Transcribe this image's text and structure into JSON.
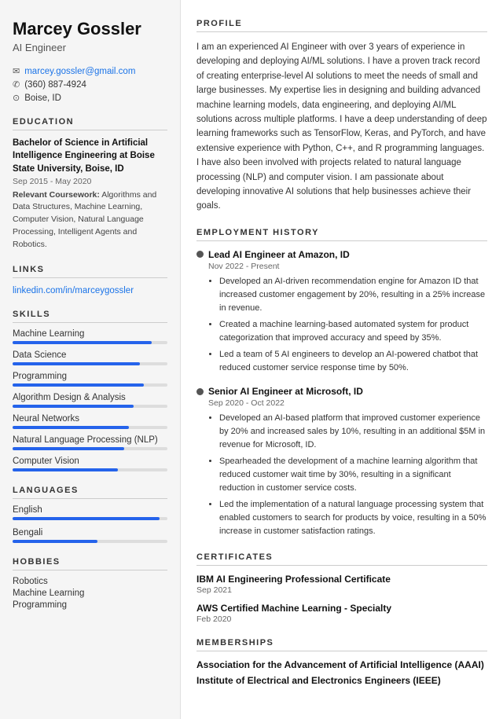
{
  "sidebar": {
    "name": "Marcey Gossler",
    "job_title": "AI Engineer",
    "contact": {
      "email": "marcey.gossler@gmail.com",
      "phone": "(360) 887-4924",
      "location": "Boise, ID"
    },
    "education": {
      "degree": "Bachelor of Science in Artificial Intelligence Engineering at Boise State University, Boise, ID",
      "dates": "Sep 2015 - May 2020",
      "coursework_label": "Relevant Coursework:",
      "coursework": "Algorithms and Data Structures, Machine Learning, Computer Vision, Natural Language Processing, Intelligent Agents and Robotics."
    },
    "links": {
      "label": "linkedin.com/in/marceygossler",
      "href": "linkedin.com/in/marceygossler"
    },
    "skills": [
      {
        "name": "Machine Learning",
        "pct": 90
      },
      {
        "name": "Data Science",
        "pct": 82
      },
      {
        "name": "Programming",
        "pct": 85
      },
      {
        "name": "Algorithm Design & Analysis",
        "pct": 78
      },
      {
        "name": "Neural Networks",
        "pct": 75
      },
      {
        "name": "Natural Language Processing (NLP)",
        "pct": 72
      },
      {
        "name": "Computer Vision",
        "pct": 68
      }
    ],
    "languages": [
      {
        "name": "English",
        "pct": 95
      },
      {
        "name": "Bengali",
        "pct": 55
      }
    ],
    "hobbies": [
      "Robotics",
      "Machine Learning",
      "Programming"
    ],
    "section_titles": {
      "education": "EDUCATION",
      "links": "LINKS",
      "skills": "SKILLS",
      "languages": "LANGUAGES",
      "hobbies": "HOBBIES"
    }
  },
  "main": {
    "section_titles": {
      "profile": "PROFILE",
      "employment": "EMPLOYMENT HISTORY",
      "certificates": "CERTIFICATES",
      "memberships": "MEMBERSHIPS"
    },
    "profile": "I am an experienced AI Engineer with over 3 years of experience in developing and deploying AI/ML solutions. I have a proven track record of creating enterprise-level AI solutions to meet the needs of small and large businesses. My expertise lies in designing and building advanced machine learning models, data engineering, and deploying AI/ML solutions across multiple platforms. I have a deep understanding of deep learning frameworks such as TensorFlow, Keras, and PyTorch, and have extensive experience with Python, C++, and R programming languages. I have also been involved with projects related to natural language processing (NLP) and computer vision. I am passionate about developing innovative AI solutions that help businesses achieve their goals.",
    "employment": [
      {
        "title": "Lead AI Engineer at Amazon, ID",
        "dates": "Nov 2022 - Present",
        "bullets": [
          "Developed an AI-driven recommendation engine for Amazon ID that increased customer engagement by 20%, resulting in a 25% increase in revenue.",
          "Created a machine learning-based automated system for product categorization that improved accuracy and speed by 35%.",
          "Led a team of 5 AI engineers to develop an AI-powered chatbot that reduced customer service response time by 50%."
        ]
      },
      {
        "title": "Senior AI Engineer at Microsoft, ID",
        "dates": "Sep 2020 - Oct 2022",
        "bullets": [
          "Developed an AI-based platform that improved customer experience by 20% and increased sales by 10%, resulting in an additional $5M in revenue for Microsoft, ID.",
          "Spearheaded the development of a machine learning algorithm that reduced customer wait time by 30%, resulting in a significant reduction in customer service costs.",
          "Led the implementation of a natural language processing system that enabled customers to search for products by voice, resulting in a 50% increase in customer satisfaction ratings."
        ]
      }
    ],
    "certificates": [
      {
        "name": "IBM AI Engineering Professional Certificate",
        "date": "Sep 2021"
      },
      {
        "name": "AWS Certified Machine Learning - Specialty",
        "date": "Feb 2020"
      }
    ],
    "memberships": [
      "Association for the Advancement of Artificial Intelligence (AAAI)",
      "Institute of Electrical and Electronics Engineers (IEEE)"
    ]
  }
}
